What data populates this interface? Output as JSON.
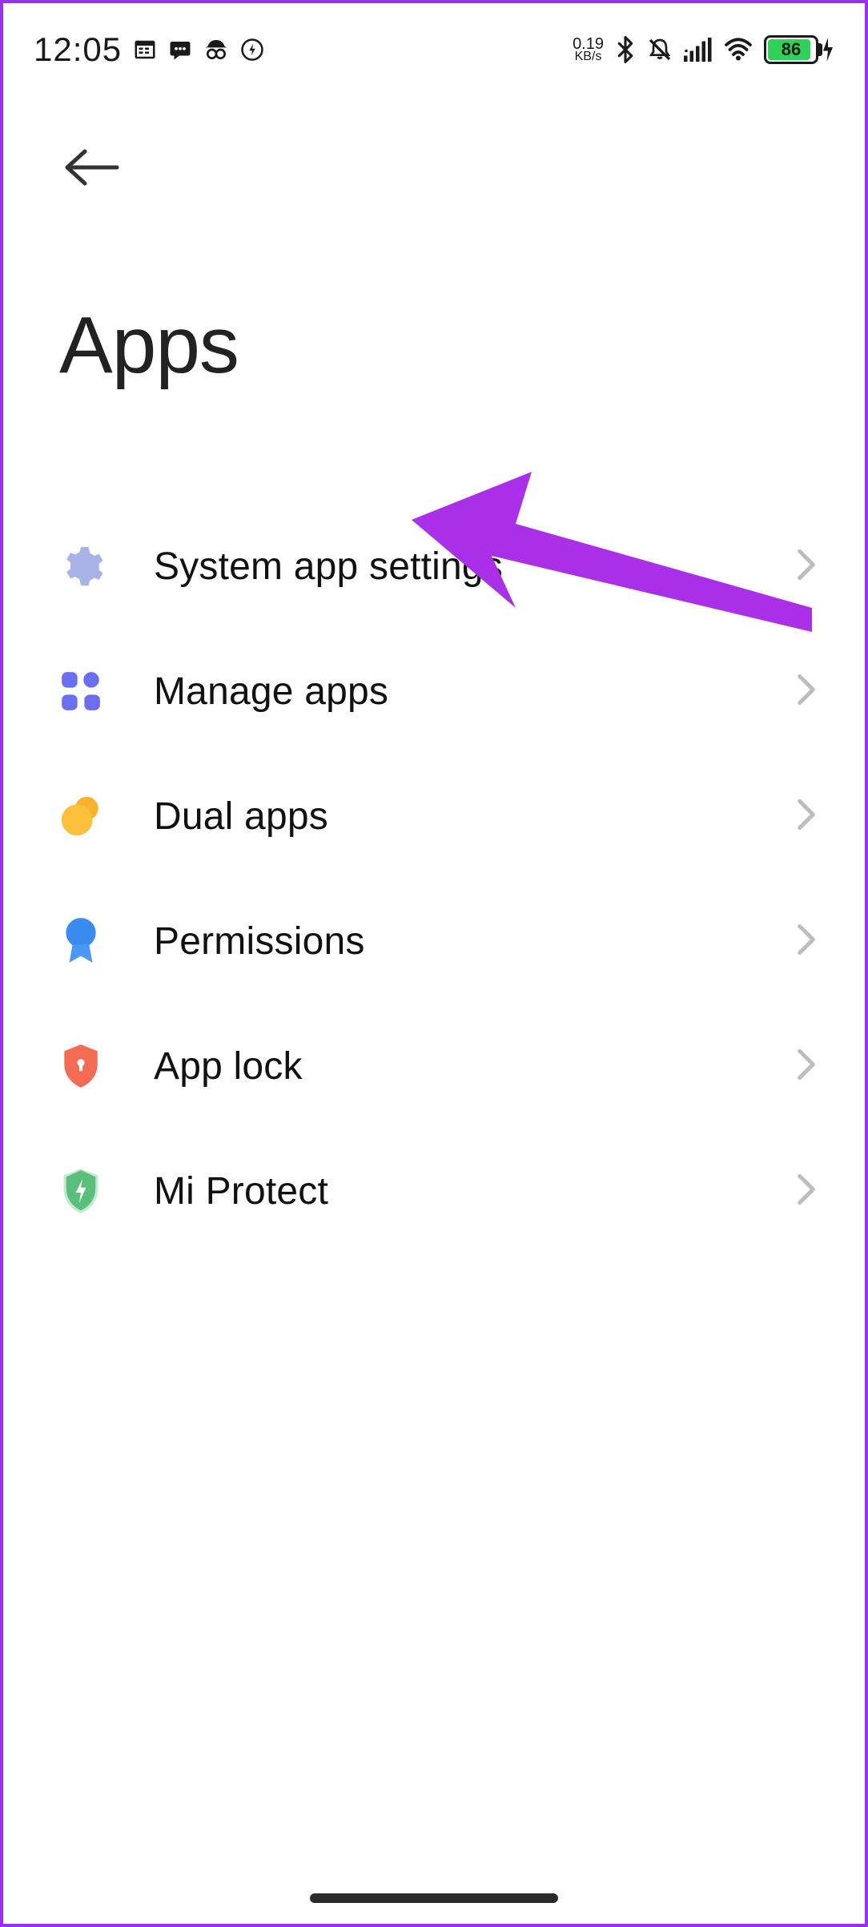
{
  "status": {
    "time": "12:05",
    "net_speed_value": "0.19",
    "net_speed_unit": "KB/s",
    "battery_percent": "86",
    "battery_fill_pct": 86
  },
  "header": {
    "title": "Apps"
  },
  "list": {
    "items": [
      {
        "id": "system-app-settings",
        "label": "System app settings",
        "icon": "gear",
        "icon_color": "#a9b3e8"
      },
      {
        "id": "manage-apps",
        "label": "Manage apps",
        "icon": "apps-grid",
        "icon_color": "#6a6ff2"
      },
      {
        "id": "dual-apps",
        "label": "Dual apps",
        "icon": "dual-circle",
        "icon_color": "#f7b22e"
      },
      {
        "id": "permissions",
        "label": "Permissions",
        "icon": "award",
        "icon_color": "#3a8cf0"
      },
      {
        "id": "app-lock",
        "label": "App lock",
        "icon": "shield-lock",
        "icon_color": "#f46b54"
      },
      {
        "id": "mi-protect",
        "label": "Mi Protect",
        "icon": "shield-bolt",
        "icon_color": "#5abf7a"
      }
    ]
  },
  "annotation": {
    "color": "#a92fe8",
    "target_item": "manage-apps"
  }
}
